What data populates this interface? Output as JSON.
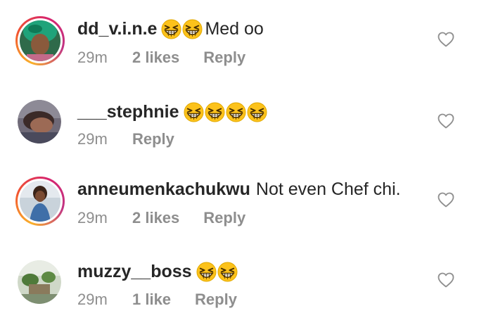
{
  "comments": [
    {
      "username": "dd_v.i.n.e",
      "emoji_before": [
        "grinning-squinting-face",
        "grinning-squinting-face"
      ],
      "text": "Med oo",
      "time": "29m",
      "likes": "2 likes",
      "reply": "Reply",
      "story_ring": true
    },
    {
      "username": "___stephnie",
      "emoji_before": [
        "grinning-squinting-face",
        "grinning-squinting-face",
        "grinning-squinting-face",
        "grinning-squinting-face"
      ],
      "text": "",
      "time": "29m",
      "likes": "",
      "reply": "Reply",
      "story_ring": false
    },
    {
      "username": "anneumenkachukwu",
      "emoji_before": [],
      "text": "Not even Chef chi.",
      "time": "29m",
      "likes": "2 likes",
      "reply": "Reply",
      "story_ring": true
    },
    {
      "username": "muzzy__boss",
      "emoji_before": [
        "grinning-squinting-face",
        "grinning-squinting-face"
      ],
      "text": "",
      "time": "29m",
      "likes": "1 like",
      "reply": "Reply",
      "story_ring": false
    }
  ],
  "colors": {
    "text": "#262626",
    "meta": "#8e8e8e",
    "heart_outline": "#8e8e8e",
    "ring_start": "#f9b12b",
    "ring_end": "#c13584",
    "emoji_face": "#fcc21b"
  },
  "icons": {
    "like": "heart-outline-icon",
    "emoji": "grinning-squinting-face"
  }
}
